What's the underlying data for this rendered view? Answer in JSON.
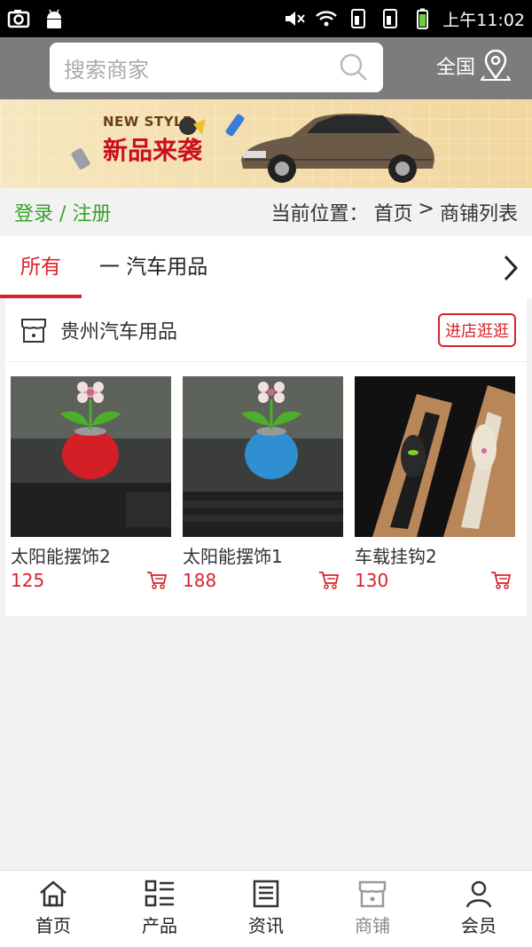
{
  "status_bar": {
    "time": "上午11:02",
    "icons": [
      "camera-icon",
      "android-icon",
      "mute-icon",
      "wifi-icon",
      "sim1-icon",
      "sim2-icon",
      "battery-icon"
    ]
  },
  "header": {
    "search_placeholder": "搜索商家",
    "region_label": "全国"
  },
  "banner": {
    "subtitle": "NEW STYLE",
    "title": "新品来袭"
  },
  "breadcrumb": {
    "login_label": "登录 / 注册",
    "location_prefix": "当前位置：",
    "home": "首页",
    "separator": ">",
    "current": "商铺列表"
  },
  "tabs": [
    {
      "label": "所有",
      "active": true
    },
    {
      "label": "一 汽车用品",
      "active": false
    }
  ],
  "shop": {
    "name": "贵州汽车用品",
    "enter_label": "进店逛逛",
    "products": [
      {
        "name": "太阳能摆饰2",
        "price": "125",
        "image_icon": "red-flower-pot-image"
      },
      {
        "name": "太阳能摆饰1",
        "price": "188",
        "image_icon": "blue-flower-pot-image"
      },
      {
        "name": "车载挂钩2",
        "price": "130",
        "image_icon": "car-hook-image"
      }
    ]
  },
  "bottom_nav": [
    {
      "label": "首页",
      "icon": "home-icon"
    },
    {
      "label": "产品",
      "icon": "list-icon"
    },
    {
      "label": "资讯",
      "icon": "news-icon"
    },
    {
      "label": "商铺",
      "icon": "shop-icon"
    },
    {
      "label": "会员",
      "icon": "user-icon"
    }
  ],
  "colors": {
    "accent": "#d8232a",
    "login_green": "#3aa12d",
    "header_bg": "#7c7c7c"
  }
}
